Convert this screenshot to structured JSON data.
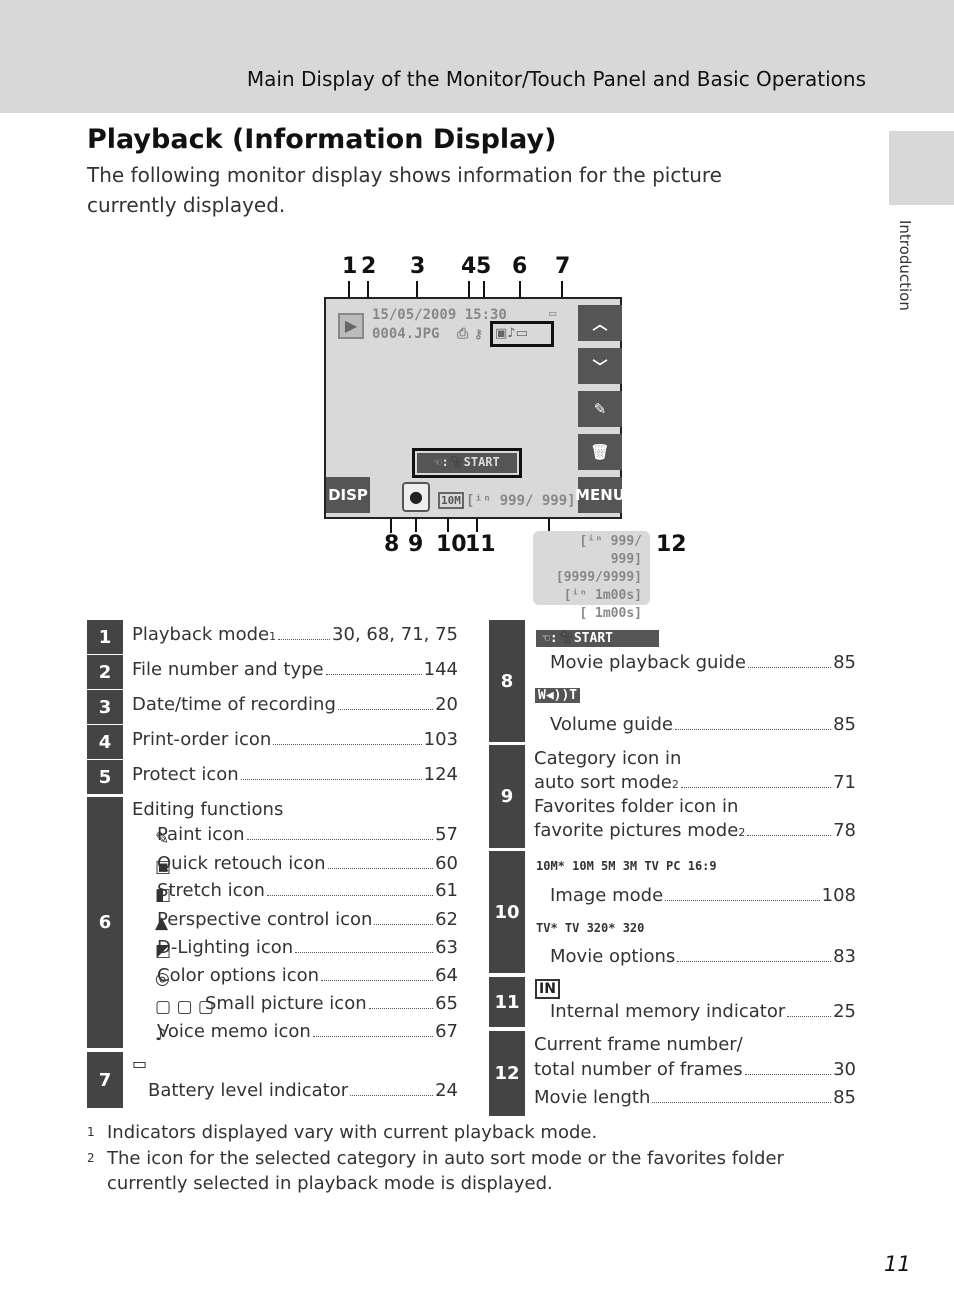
{
  "header": {
    "section": "Main Display of the Monitor/Touch Panel and Basic Operations",
    "side_tab": "Introduction"
  },
  "title": "Playback (Information Display)",
  "intro": "The following monitor display shows information for the picture currently displayed.",
  "monitor": {
    "date": "15/05/2009 15:30",
    "file": "0004.JPG",
    "movie_guide": "☜:🎥START",
    "frame_count": "[ⁱⁿ 999/ 999]",
    "disp": "DISP",
    "menu": "MENU",
    "image_mode": "10M",
    "callouts_top": [
      "1",
      "2",
      "3",
      "4",
      "5",
      "6",
      "7"
    ],
    "callouts_bottom": [
      "8",
      "9",
      "10",
      "11"
    ],
    "callout_12": "12",
    "frames": [
      "[ⁱⁿ 999/ 999]",
      "[9999/9999]",
      "[ⁱⁿ 1m00s]",
      "[ 1m00s]"
    ]
  },
  "left_table": [
    {
      "n": "1",
      "label": "Playback mode",
      "sup": "1",
      "page": "30, 68, 71, 75"
    },
    {
      "n": "2",
      "label": "File number and type",
      "page": "144"
    },
    {
      "n": "3",
      "label": "Date/time of recording",
      "page": "20"
    },
    {
      "n": "4",
      "label": "Print-order icon",
      "page": "103"
    },
    {
      "n": "5",
      "label": "Protect icon",
      "page": "124"
    },
    {
      "n": "6",
      "heading": "Editing functions",
      "items": [
        {
          "label": "Paint icon",
          "page": "57",
          "icon": "paint-icon"
        },
        {
          "label": "Quick retouch icon",
          "page": "60",
          "icon": "quick-retouch-icon"
        },
        {
          "label": "Stretch icon",
          "page": "61",
          "icon": "stretch-icon"
        },
        {
          "label": "Perspective control icon",
          "page": "62",
          "icon": "perspective-icon"
        },
        {
          "label": "D-Lighting icon",
          "page": "63",
          "icon": "d-lighting-icon"
        },
        {
          "label": "Color options icon",
          "page": "64",
          "icon": "color-options-icon"
        },
        {
          "label": "Small picture icon",
          "page": "65",
          "icon": "small-picture-icon"
        },
        {
          "label": "Voice memo icon",
          "page": "67",
          "icon": "voice-memo-icon"
        }
      ]
    },
    {
      "n": "7",
      "label": "Battery level indicator",
      "page": "24",
      "icon": "battery-icon"
    }
  ],
  "right_table": [
    {
      "n": "8",
      "items": [
        {
          "icon_text": "☜:🎥START",
          "label": "Movie playback guide",
          "page": "85"
        },
        {
          "icon_text": "W◀))T",
          "label": "Volume guide",
          "page": "85"
        }
      ]
    },
    {
      "n": "9",
      "items": [
        {
          "line1": "Category icon in",
          "label": "auto sort mode",
          "sup": "2",
          "page": "71"
        },
        {
          "line1": "Favorites folder icon in",
          "label": "favorite pictures mode",
          "sup": "2",
          "page": "78"
        }
      ]
    },
    {
      "n": "10",
      "items": [
        {
          "icon_text": "10M* 10M 5M 3M TV PC 16:9",
          "label": "Image mode",
          "page": "108"
        },
        {
          "icon_text": "TV* TV 320* 320",
          "label": "Movie options",
          "page": "83"
        }
      ]
    },
    {
      "n": "11",
      "items": [
        {
          "icon_text": "IN",
          "label": "Internal memory indicator",
          "page": "25"
        }
      ]
    },
    {
      "n": "12",
      "items": [
        {
          "line1": "Current frame number/",
          "label": "total number of frames",
          "page": "30"
        },
        {
          "label": "Movie length",
          "page": "85"
        }
      ]
    }
  ],
  "footnotes": [
    {
      "mark": "1",
      "text": "Indicators displayed vary with current playback mode."
    },
    {
      "mark": "2",
      "text": "The icon for the selected category in auto sort mode or the favorites folder currently selected in playback mode is displayed."
    }
  ],
  "page_number": "11"
}
